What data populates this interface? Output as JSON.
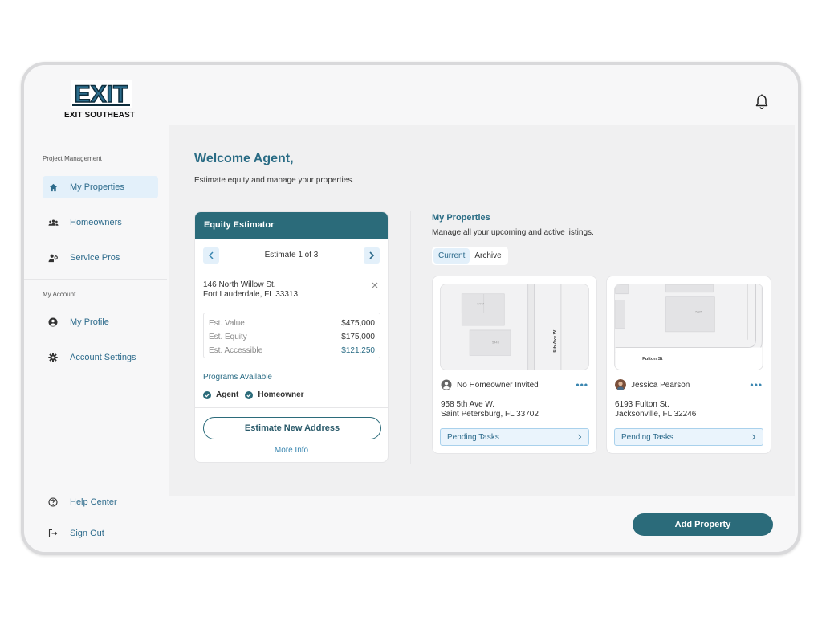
{
  "brand": {
    "logo_text": "EXIT SOUTHEAST",
    "logo_mark": "EXIT",
    "accent": "#2b6b7a",
    "link": "#2d6b8c"
  },
  "header": {
    "notifications_icon": "bell-icon"
  },
  "sidebar": {
    "project_section": "Project Management",
    "account_section": "My Account",
    "project_items": [
      {
        "label": "My Properties",
        "icon": "home-icon",
        "active": true
      },
      {
        "label": "Homeowners",
        "icon": "group-icon",
        "active": false
      },
      {
        "label": "Service Pros",
        "icon": "person-gear-icon",
        "active": false
      }
    ],
    "account_items": [
      {
        "label": "My Profile",
        "icon": "user-circle-icon"
      },
      {
        "label": "Account Settings",
        "icon": "gear-icon"
      }
    ],
    "footer_items": [
      {
        "label": "Help Center",
        "icon": "help-icon"
      },
      {
        "label": "Sign Out",
        "icon": "sign-out-icon"
      }
    ]
  },
  "main": {
    "welcome": "Welcome Agent,",
    "welcome_sub": "Estimate equity and manage your properties."
  },
  "estimator": {
    "title": "Equity Estimator",
    "counter": "Estimate 1 of 3",
    "address_line1": "146 North Willow St.",
    "address_line2": "Fort Lauderdale, FL 33313",
    "values": [
      {
        "label": "Est. Value",
        "value": "$475,000"
      },
      {
        "label": "Est. Equity",
        "value": "$175,000"
      },
      {
        "label": "Est. Accessible",
        "value": "$121,250"
      }
    ],
    "programs_title": "Programs Available",
    "programs": [
      "Agent",
      "Homeowner"
    ],
    "button": "Estimate New Address",
    "more_info": "More Info"
  },
  "properties": {
    "title": "My Properties",
    "subtitle": "Manage all your upcoming and active listings.",
    "tabs": [
      {
        "label": "Current",
        "active": true
      },
      {
        "label": "Archive",
        "active": false
      }
    ],
    "cards": [
      {
        "owner": "No Homeowner Invited",
        "address_line1": "958 5th Ave W.",
        "address_line2": "Saint Petersburg, FL 33702",
        "pending": "Pending Tasks",
        "map_street": "5th Ave W",
        "map_numbers": [
          "5447",
          "5443"
        ]
      },
      {
        "owner": "Jessica Pearson",
        "address_line1": "6193 Fulton St.",
        "address_line2": "Jacksonville, FL 32246",
        "pending": "Pending Tasks",
        "map_street": "Fulton St",
        "map_numbers": [
          "5925"
        ]
      }
    ]
  },
  "actions": {
    "add_property": "Add Property"
  }
}
